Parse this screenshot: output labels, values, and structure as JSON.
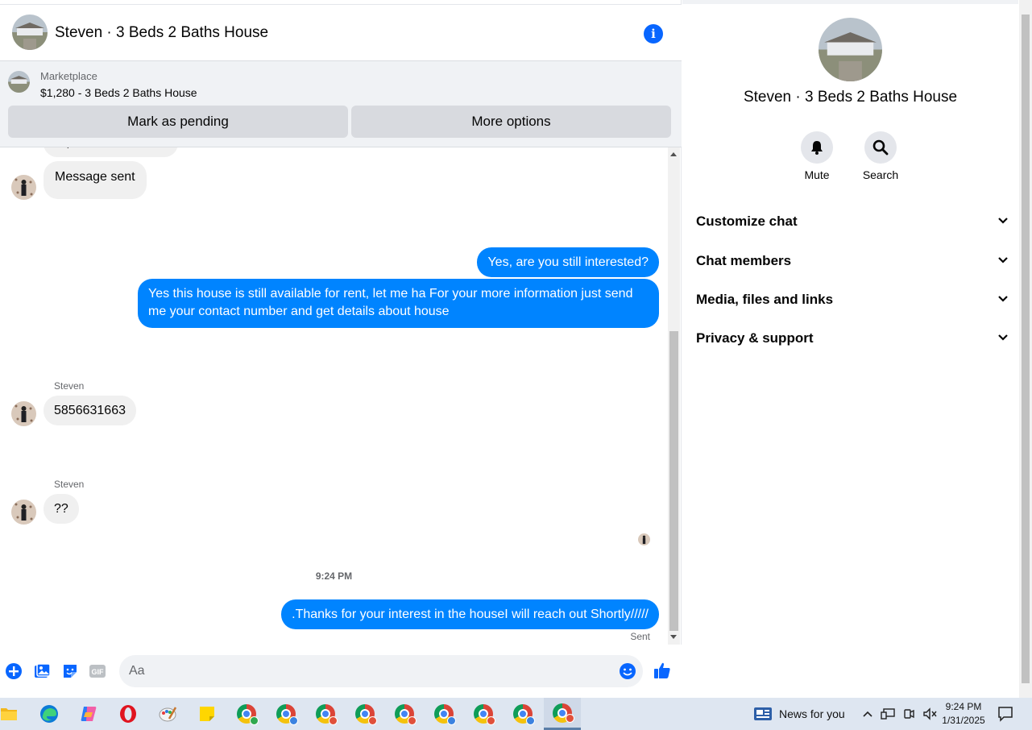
{
  "chat": {
    "title": "Steven · 3 Beds 2 Baths House",
    "marketplace_label": "Marketplace",
    "listing": "$1,280 - 3 Beds 2 Baths House",
    "pending_button": "Mark as pending",
    "more_button": "More options"
  },
  "messages": {
    "partial_text": "Hi, is this available?",
    "sent_notice": "Message sent",
    "out_1": "Yes, are you still interested?",
    "out_2": "Yes this house is still available for rent, let me ha For  your  more  information  just send  me   your  contact  number  and get details about house",
    "sender_1": "Steven",
    "in_1": "5856631663",
    "sender_2": "Steven",
    "in_2": "??",
    "timestamp": "9:24 PM",
    "out_3": ".Thanks for your interest in the houseI will reach out Shortly/////",
    "status": "Sent"
  },
  "composer": {
    "placeholder": "Aa",
    "icons": [
      "plus-icon",
      "photo-icon",
      "sticker-icon",
      "gif-icon",
      "emoji-icon",
      "like-icon"
    ],
    "gif_label": "GIF"
  },
  "details": {
    "title": "Steven · 3 Beds 2 Baths House",
    "actions": [
      {
        "label": "Mute",
        "icon": "bell-icon"
      },
      {
        "label": "Search",
        "icon": "search-icon"
      }
    ],
    "sections": [
      "Customize chat",
      "Chat members",
      "Media, files and links",
      "Privacy & support"
    ]
  },
  "taskbar": {
    "news_label": "News for you",
    "time": "9:24 PM",
    "date": "1/31/2025",
    "apps": [
      "file-explorer",
      "edge",
      "copilot",
      "opera",
      "paint",
      "sticky-notes",
      "chrome",
      "chrome",
      "chrome",
      "chrome",
      "chrome",
      "chrome",
      "chrome",
      "chrome",
      "chrome"
    ]
  },
  "colors": {
    "accent": "#0084ff",
    "brand_blue": "#0866ff",
    "incoming_bubble": "#f0f0f0",
    "bar_background": "#f0f2f5",
    "button_grey": "#d8dadf"
  }
}
